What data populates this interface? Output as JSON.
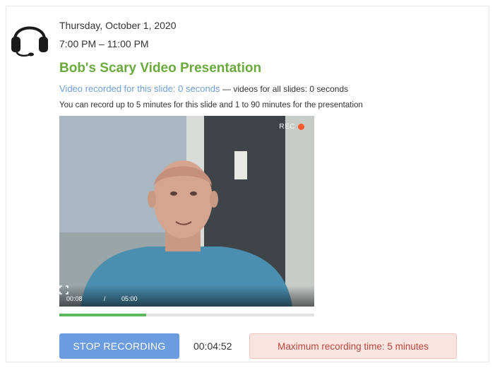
{
  "event": {
    "date": "Thursday, October 1, 2020",
    "time": "7:00 PM – 11:00 PM",
    "title": "Bob's Scary Video Presentation"
  },
  "recording_info": {
    "slide_label": "Video recorded for this slide:",
    "slide_value": "0 seconds",
    "all_slides": "— videos for all slides: 0 seconds",
    "limits": "You can record up to 5 minutes for this slide and 1 to 90 minutes for the presentation"
  },
  "video": {
    "rec_label": "REC",
    "current_time": "00:08",
    "separator": "/",
    "duration": "05:00",
    "icons": [
      "fullscreen-icon",
      "rec-dot"
    ]
  },
  "progress": {
    "fraction": 0.34
  },
  "actions": {
    "stop_label": "STOP RECORDING",
    "timer": "00:04:52",
    "max_notice": "Maximum recording time: 5 minutes"
  },
  "icons": {
    "avatar": "headset-icon"
  },
  "colors": {
    "title_green": "#6aaa3c",
    "link_blue": "#6f9fd8",
    "button_blue": "#6b9ce0",
    "progress_green": "#5cb85c",
    "rec_red": "#ff5a2e",
    "notice_bg": "#fbe5e1",
    "notice_text": "#b8463a"
  }
}
